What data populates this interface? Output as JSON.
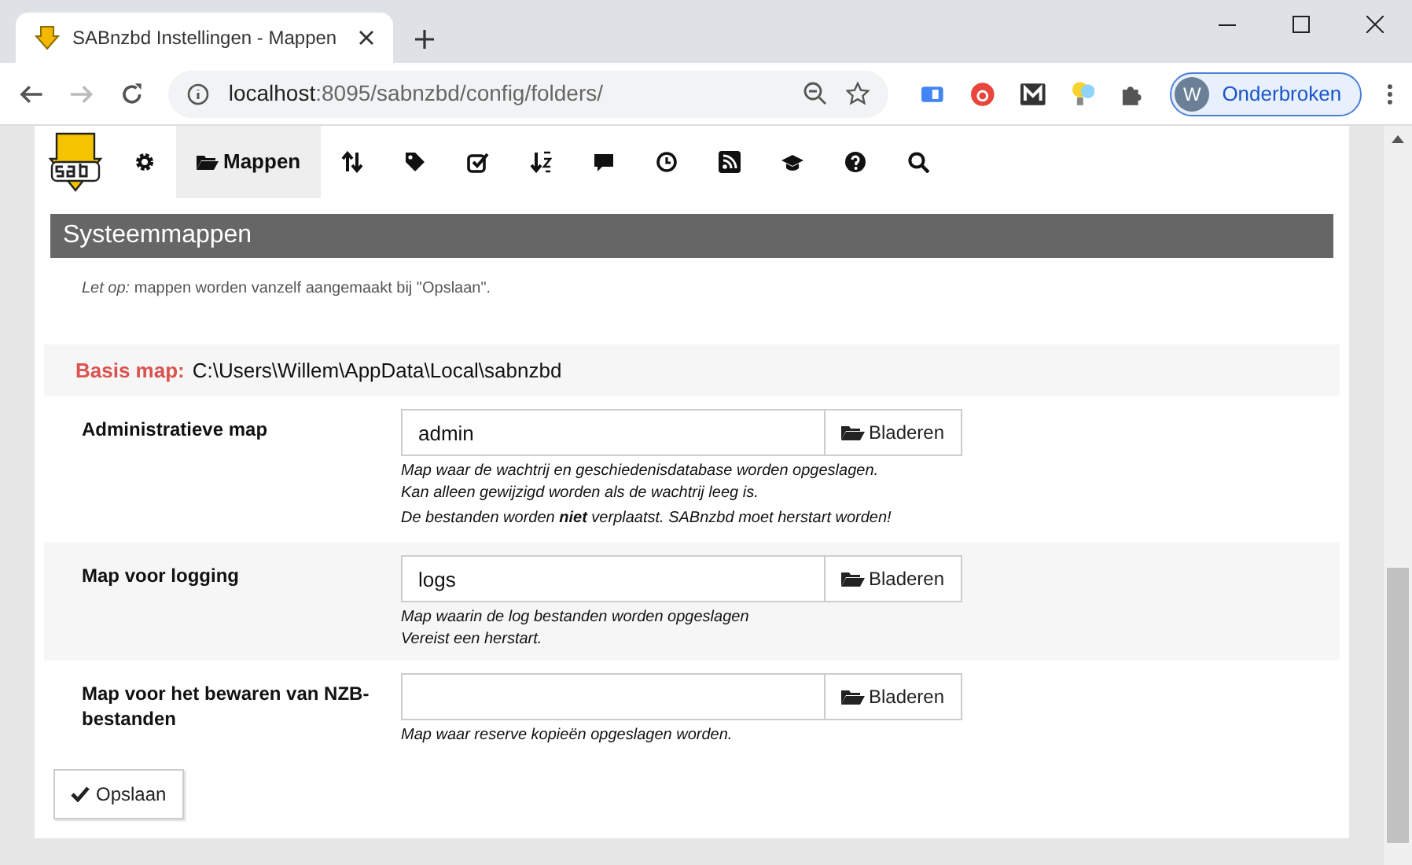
{
  "browser": {
    "tab_title": "SABnzbd Instellingen - Mappen",
    "address_host": "localhost",
    "address_rest": ":8095/sabnzbd/config/folders/",
    "profile_initial": "W",
    "profile_label": "Onderbroken"
  },
  "nav": {
    "items": [
      {
        "kind": "settings",
        "selected": false
      },
      {
        "kind": "folders",
        "label": "Mappen",
        "selected": true
      },
      {
        "kind": "switches",
        "selected": false
      },
      {
        "kind": "categories",
        "selected": false
      },
      {
        "kind": "scheduling",
        "selected": false
      },
      {
        "kind": "sorting",
        "selected": false
      },
      {
        "kind": "notifications",
        "selected": false
      },
      {
        "kind": "scheduler",
        "selected": false
      },
      {
        "kind": "rss",
        "selected": false
      },
      {
        "kind": "special",
        "selected": false
      },
      {
        "kind": "help",
        "selected": false
      },
      {
        "kind": "search",
        "selected": false
      }
    ]
  },
  "section": {
    "title": "Systeemmappen",
    "note": "*Let op:* mappen worden vanzelf aangemaakt bij \"Opslaan\".",
    "base": {
      "label": "Basis map:",
      "value": "C:\\Users\\Willem\\AppData\\Local\\sabnzbd"
    },
    "fields": [
      {
        "label": "Administratieve map",
        "value": "admin",
        "button": "Bladeren",
        "hints": [
          "Map waar de wachtrij en geschiedenisdatabase worden opgeslagen.",
          "Kan alleen gewijzigd worden als de wachtrij leeg is.",
          "De bestanden worden **niet** verplaatst. SABnzbd moet herstart worden!"
        ]
      },
      {
        "label": "Map voor logging",
        "value": "logs",
        "button": "Bladeren",
        "hints": [
          "Map waarin de log bestanden worden opgeslagen",
          "Vereist een herstart."
        ]
      },
      {
        "label": "Map voor het bewaren van NZB-bestanden",
        "button": "Bladeren",
        "hints": [
          "Map waar reserve kopieën opgeslagen worden."
        ]
      }
    ]
  },
  "save_button": "Opslaan"
}
